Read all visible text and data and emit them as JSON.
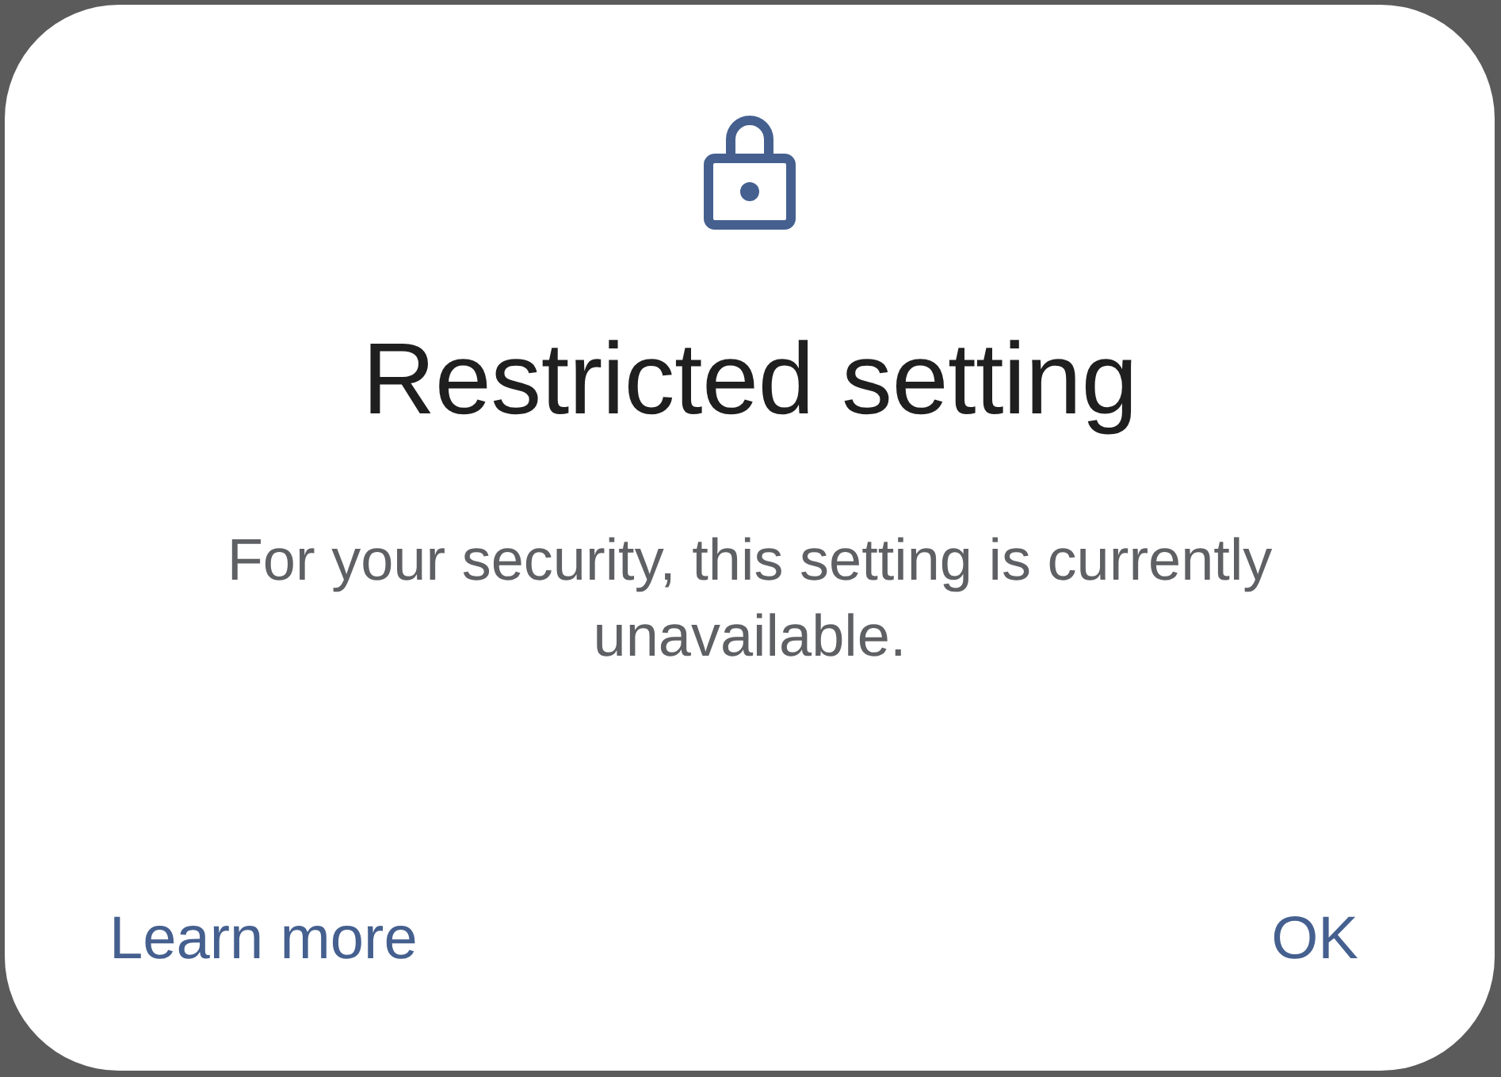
{
  "dialog": {
    "title": "Restricted setting",
    "message": "For your security, this setting is currently unavailable.",
    "buttons": [
      {
        "label": "Learn more",
        "kind": "link"
      },
      {
        "label": "OK",
        "kind": "confirm"
      }
    ]
  }
}
